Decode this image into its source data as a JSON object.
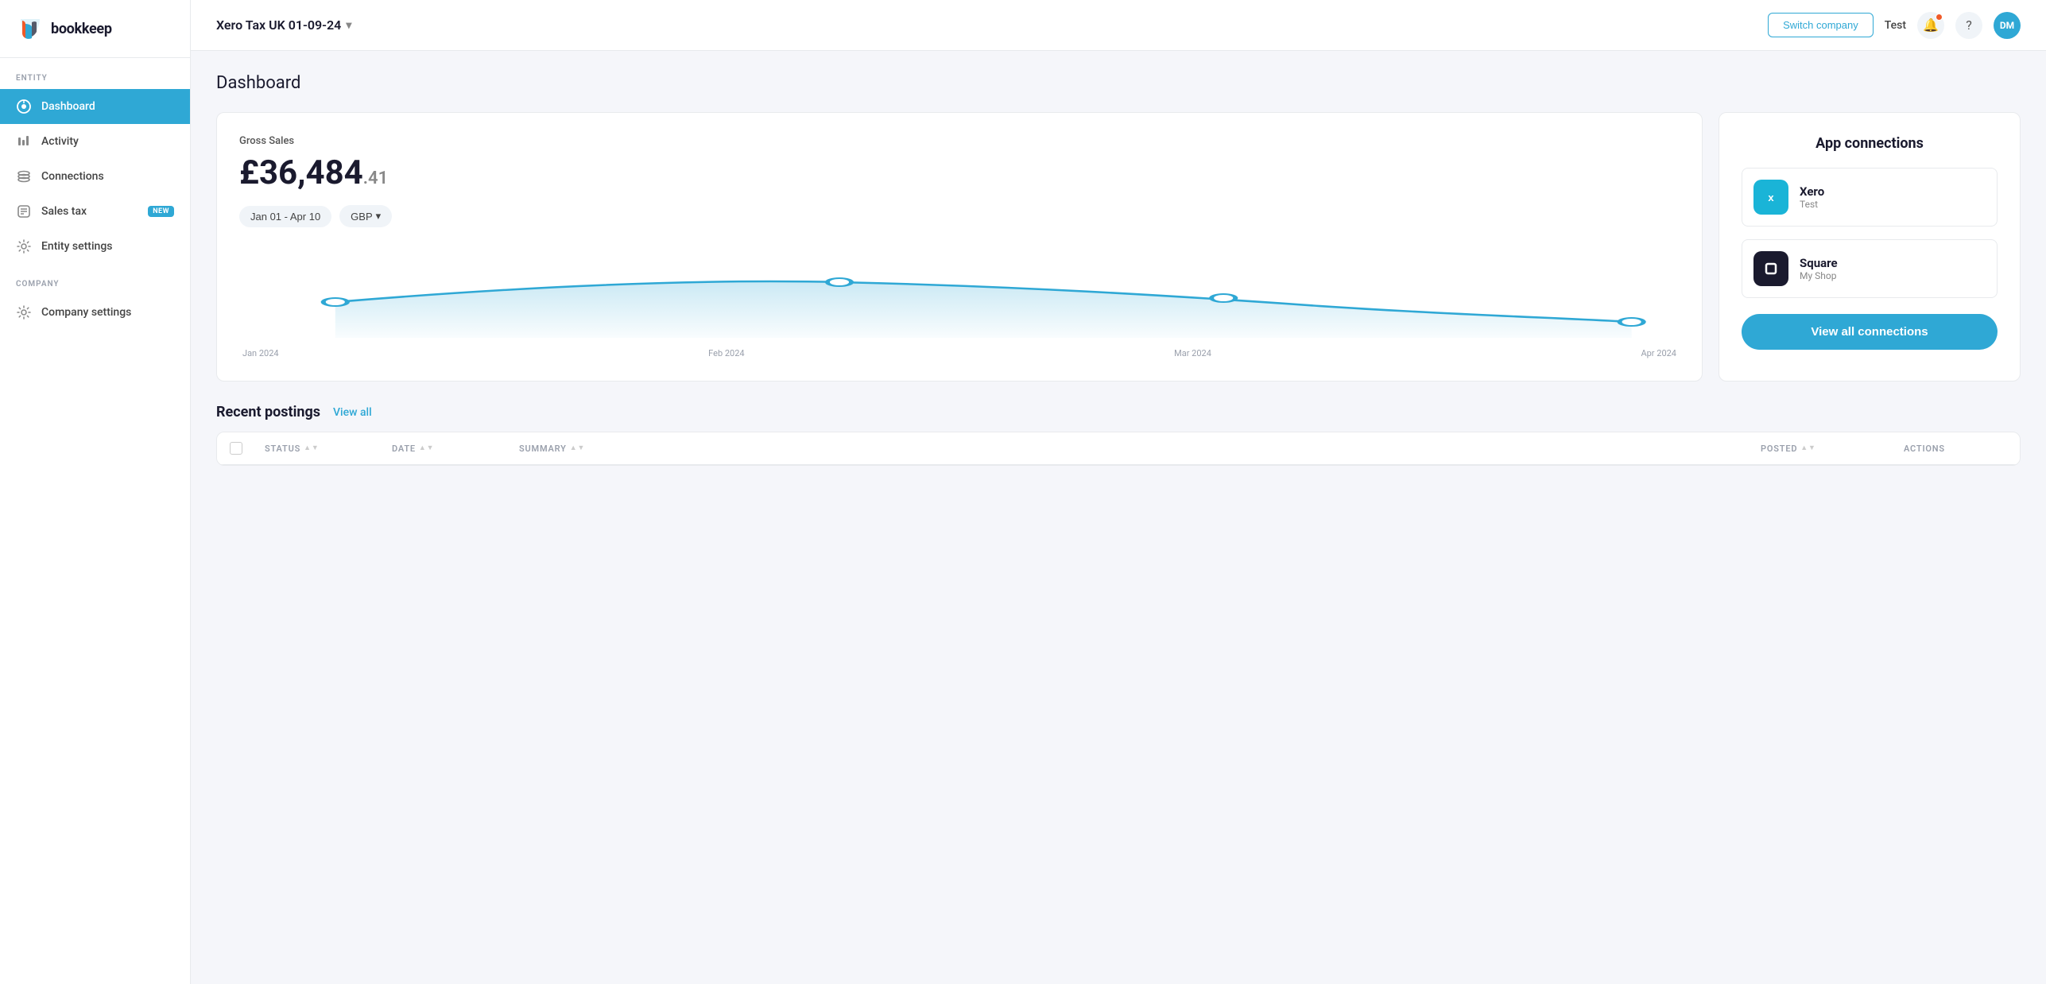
{
  "brand": {
    "name": "bookkeep",
    "logo_alt": "bookkeep logo"
  },
  "header": {
    "company_name": "Xero Tax UK 01-09-24",
    "switch_company_label": "Switch company",
    "user_name": "Test",
    "user_initials": "DM"
  },
  "sidebar": {
    "entity_label": "ENTITY",
    "company_label": "COMPANY",
    "nav_items": [
      {
        "id": "dashboard",
        "label": "Dashboard",
        "active": true
      },
      {
        "id": "activity",
        "label": "Activity",
        "active": false
      },
      {
        "id": "connections",
        "label": "Connections",
        "active": false
      },
      {
        "id": "sales-tax",
        "label": "Sales tax",
        "active": false,
        "badge": "NEW"
      },
      {
        "id": "entity-settings",
        "label": "Entity settings",
        "active": false
      }
    ],
    "company_items": [
      {
        "id": "company-settings",
        "label": "Company settings",
        "active": false
      }
    ]
  },
  "dashboard": {
    "title": "Dashboard",
    "gross_sales": {
      "label": "Gross Sales",
      "amount_main": "£36,484",
      "amount_decimal": ".41",
      "date_range": "Jan 01 - Apr 10",
      "currency": "GBP",
      "chart_labels": [
        "Jan 2024",
        "Feb 2024",
        "Mar 2024",
        "Apr 2024"
      ]
    },
    "app_connections": {
      "title": "App connections",
      "connections": [
        {
          "name": "Xero",
          "sub": "Test",
          "type": "xero"
        },
        {
          "name": "Square",
          "sub": "My Shop",
          "type": "square"
        }
      ],
      "view_all_label": "View all connections"
    },
    "recent_postings": {
      "title": "Recent postings",
      "view_all_label": "View all",
      "columns": [
        "STATUS",
        "DATE",
        "SUMMARY",
        "POSTED",
        "ACTIONS"
      ]
    }
  }
}
